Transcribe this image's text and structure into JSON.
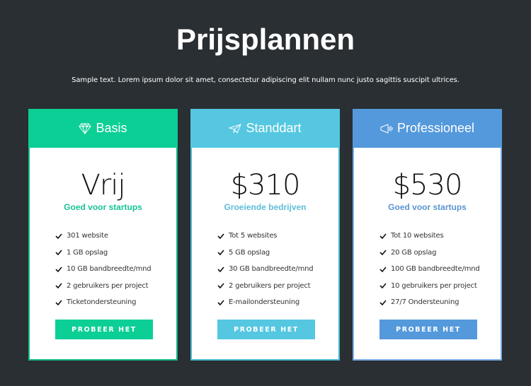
{
  "header": {
    "title": "Prijsplannen",
    "subtitle": "Sample text. Lorem ipsum dolor sit amet, consectetur adipiscing elit nullam nunc justo sagittis suscipit ultrices."
  },
  "plans": [
    {
      "name": "Basis",
      "icon": "diamond-icon",
      "price": "Vrij",
      "tagline": "Goed voor startups",
      "accent_color": "#0ccf96",
      "features": [
        "301 website",
        "1 GB opslag",
        "10 GB bandbreedte/mnd",
        "2 gebruikers per project",
        "Ticketondersteuning"
      ],
      "button_label": "PROBEER HET"
    },
    {
      "name": "Standdart",
      "icon": "paper-plane-icon",
      "price": "$310",
      "tagline": "Groeiende bedrijven",
      "accent_color": "#55c7e1",
      "features": [
        "Tot 5 websites",
        "5 GB opslag",
        "30 GB bandbreedte/mnd",
        "2 gebruikers per project",
        "E-mailondersteuning"
      ],
      "button_label": "PROBEER HET"
    },
    {
      "name": "Professioneel",
      "icon": "megaphone-icon",
      "price": "$530",
      "tagline": "Goed voor startups",
      "accent_color": "#5499dc",
      "features": [
        "Tot 10 websites",
        "20 GB opslag",
        "100 GB bandbreedte/mnd",
        "10 gebruikers per project",
        "27/7 Ondersteuning"
      ],
      "button_label": "PROBEER HET"
    }
  ]
}
